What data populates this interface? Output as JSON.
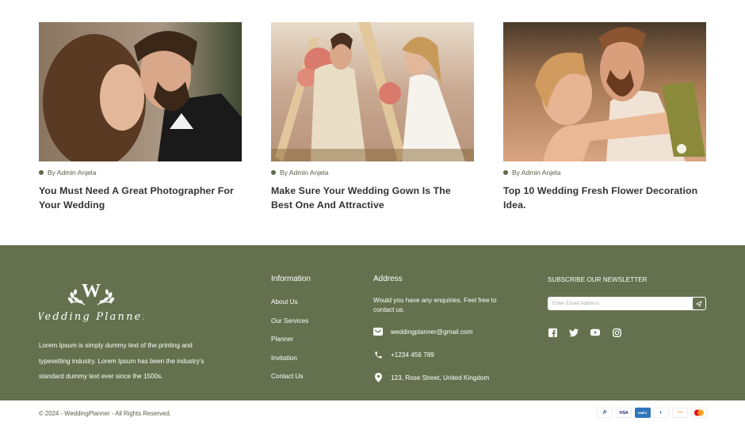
{
  "posts": [
    {
      "meta": "By Admin Anjela",
      "title": "You Must Need A Great Photographer For Your Wedding",
      "image": "couple-forehead-touch-photo"
    },
    {
      "meta": "By Admin Anjela",
      "title": "Make Sure Your Wedding Gown Is The Best One And Attractive",
      "image": "couple-floral-arch-photo"
    },
    {
      "meta": "By Admin Anjela",
      "title": "Top 10 Wedding Fresh Flower Decoration Idea.",
      "image": "couple-embrace-bouquet-photo"
    }
  ],
  "footer": {
    "brand": {
      "monogram": "W",
      "name": "Wedding Planner"
    },
    "about": "Lorem Ipsum is simply dummy text of  the printing and typesetting industry. Lorem Ipsum has been the industry's standard dummy text ever since the 1500s.",
    "information": {
      "heading": "Information",
      "links": [
        "About Us",
        "Our Services",
        "Planner",
        "Invitation",
        "Contact Us"
      ]
    },
    "address": {
      "heading": "Address",
      "intro": "Would you have any enquiries. Feel free to contact us.",
      "email": "weddingplanner@gmail.com",
      "phone": "+1234 456 789",
      "location": "123, Rose Street, United Kingdom"
    },
    "newsletter": {
      "heading": "SUBSCRIBE OUR NEWSLETTER",
      "placeholder": "Enter Email Address",
      "socials": [
        "facebook-icon",
        "twitter-icon",
        "youtube-icon",
        "instagram-icon"
      ]
    }
  },
  "bottom": {
    "copyright": "© 2024 - WeddingPlanner - All Rights Reserved.",
    "payments": [
      "PayPal",
      "VISA",
      "AMEX",
      "Diners",
      "Discover",
      "Mastercard"
    ],
    "payment_labels": [
      "P",
      "VISA",
      "AMEX",
      "◐",
      "—",
      ""
    ]
  },
  "colors": {
    "footer_bg": "#65714e",
    "accent": "#5d6b47",
    "text_dark": "#333333"
  }
}
